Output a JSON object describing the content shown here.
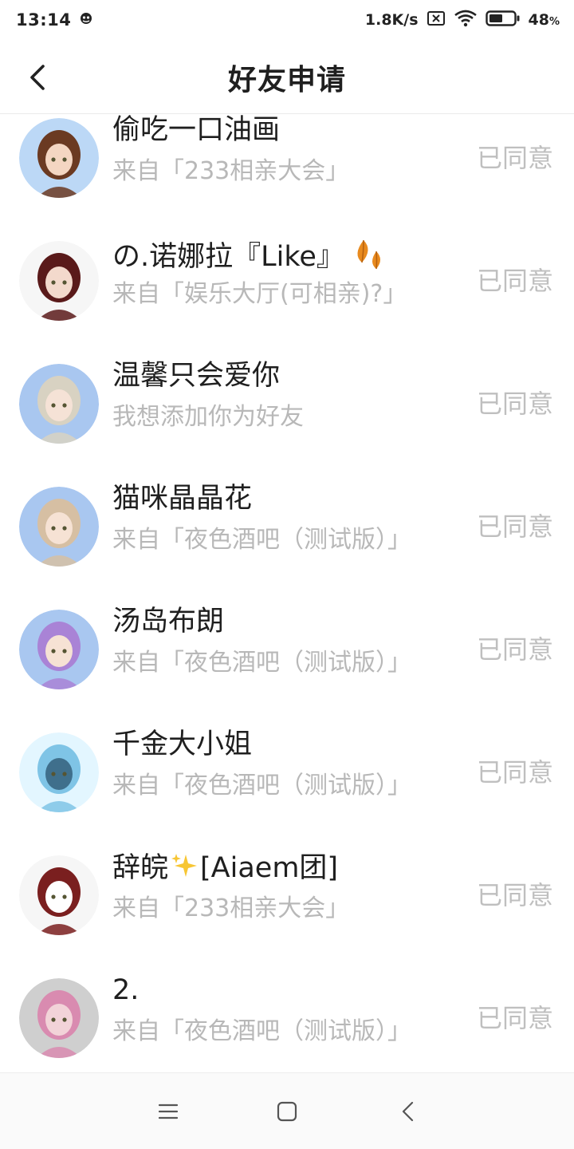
{
  "status_bar": {
    "time": "13:14",
    "net_speed": "1.8K/s",
    "battery_level": "48",
    "battery_unit": "%"
  },
  "header": {
    "title": "好友申请"
  },
  "requests": [
    {
      "name": "偷吃一口油画",
      "source": "来自「233相亲大会」",
      "status": "已同意",
      "avatar_colors": [
        "#bcd8f6",
        "#6b3a22",
        "#f4d6c2"
      ]
    },
    {
      "name": "の.诺娜拉『Like』",
      "source": "来自「娱乐大厅(可相亲)?」",
      "status": "已同意",
      "avatar_colors": [
        "#f6f6f6",
        "#5a1a1a",
        "#f3d9cc"
      ],
      "emoji": "leaves-emoji"
    },
    {
      "name": "温馨只会爱你",
      "source": "我想添加你为好友",
      "status": "已同意",
      "avatar_colors": [
        "#a9c7f0",
        "#d8d2c2",
        "#f5e2d6"
      ]
    },
    {
      "name": "猫咪晶晶花",
      "source": "来自「夜色酒吧（测试版）」",
      "status": "已同意",
      "avatar_colors": [
        "#a9c7f0",
        "#d6bfa3",
        "#f6e2d4"
      ]
    },
    {
      "name": "汤岛布朗",
      "source": "来自「夜色酒吧（测试版）」",
      "status": "已同意",
      "avatar_colors": [
        "#a9c7f0",
        "#a983d6",
        "#f6e2d4"
      ]
    },
    {
      "name": "千金大小姐",
      "source": "来自「夜色酒吧（测试版）」",
      "status": "已同意",
      "avatar_colors": [
        "#e3f6ff",
        "#7fc4e6",
        "#3f6f8c"
      ]
    },
    {
      "name": "辞皖",
      "name_suffix": "[Aiaem团]",
      "source": "来自「233相亲大会」",
      "status": "已同意",
      "avatar_colors": [
        "#f6f6f6",
        "#7a1f1f",
        "#ffffff"
      ],
      "emoji": "sparkles-emoji"
    },
    {
      "name": "2.",
      "source": "来自「夜色酒吧（测试版）」",
      "status": "已同意",
      "avatar_colors": [
        "#cfcfcf",
        "#d98bb0",
        "#f2d3d8"
      ]
    }
  ],
  "nav": {
    "menu_icon": "menu-icon",
    "home_icon": "home-square-icon",
    "back_icon": "back-chevron-icon"
  }
}
